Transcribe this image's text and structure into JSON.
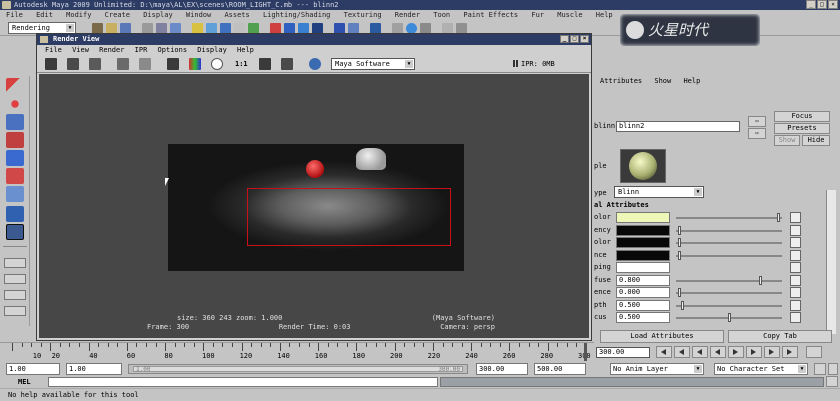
{
  "window_title": "Autodesk Maya 2009 Unlimited: D:\\maya\\AL\\EX\\scenes\\ROOM_LIGHT_C.mb  ---  blinn2",
  "menubar": [
    "File",
    "Edit",
    "Modify",
    "Create",
    "Display",
    "Window",
    "Assets",
    "Lighting/Shading",
    "Texturing",
    "Render",
    "Toon",
    "Paint Effects",
    "Fur",
    "Muscle",
    "Help"
  ],
  "statusline": {
    "mode": "Rendering"
  },
  "brand_text": "火星时代",
  "render_view": {
    "title": "Render View",
    "menu": [
      "File",
      "View",
      "Render",
      "IPR",
      "Options",
      "Display",
      "Help"
    ],
    "ratio_label": "1:1",
    "renderer": "Maya Software",
    "ipr_label": "IPR: 0MB",
    "info": {
      "size": "size:  360  243 zoom: 1.000",
      "engine": "(Maya Software)",
      "frame": "Frame: 300",
      "render_time": "Render Time: 0:03",
      "camera": "Camera: persp"
    }
  },
  "attribute_editor": {
    "menu": [
      "Attributes",
      "Show",
      "Help"
    ],
    "name_label": "blinn:",
    "name_value": "blinn2",
    "focus_label": "Focus",
    "presets_label": "Presets",
    "show_label": "Show",
    "hide_label": "Hide",
    "sample_label": "ple",
    "type_label": "ype",
    "type_value": "Blinn",
    "section_header": "al Attributes",
    "rows": [
      {
        "label": "olor",
        "value": "",
        "swatch": "#eef7b8",
        "knob": 0.97
      },
      {
        "label": "ency",
        "value": "",
        "swatch": "#080808",
        "knob": 0.02
      },
      {
        "label": "olor",
        "value": "",
        "swatch": "#080808",
        "knob": 0.02
      },
      {
        "label": "nce",
        "value": "",
        "swatch": "#080808",
        "knob": 0.02
      },
      {
        "label": "ping",
        "value": "",
        "swatch": "#ffffff",
        "knob": null
      },
      {
        "label": "fuse",
        "value": "0.800",
        "swatch": "#ffffff",
        "knob": 0.8
      },
      {
        "label": "ence",
        "value": "0.000",
        "swatch": "#ffffff",
        "knob": 0.02
      },
      {
        "label": "pth",
        "value": "0.500",
        "swatch": "#ffffff",
        "knob": 0.05
      },
      {
        "label": "cus",
        "value": "0.500",
        "swatch": "#ffffff",
        "knob": 0.5
      }
    ],
    "load_label": "Load Attributes",
    "copy_label": "Copy Tab"
  },
  "timeslider": {
    "labels": [
      "10",
      "20",
      "40",
      "60",
      "80",
      "100",
      "120",
      "140",
      "160",
      "180",
      "200",
      "220",
      "240",
      "260",
      "280",
      "300"
    ],
    "current_field": "300.00"
  },
  "range": {
    "start": "1.00",
    "start2": "1.00",
    "slider_start": "1.00",
    "slider_end": "300.00",
    "end": "300.00",
    "end2": "500.00",
    "anim_layer": "No Anim Layer",
    "character": "No Character Set"
  },
  "cmdline": {
    "label": "MEL"
  },
  "help_text": "No help available for this tool"
}
